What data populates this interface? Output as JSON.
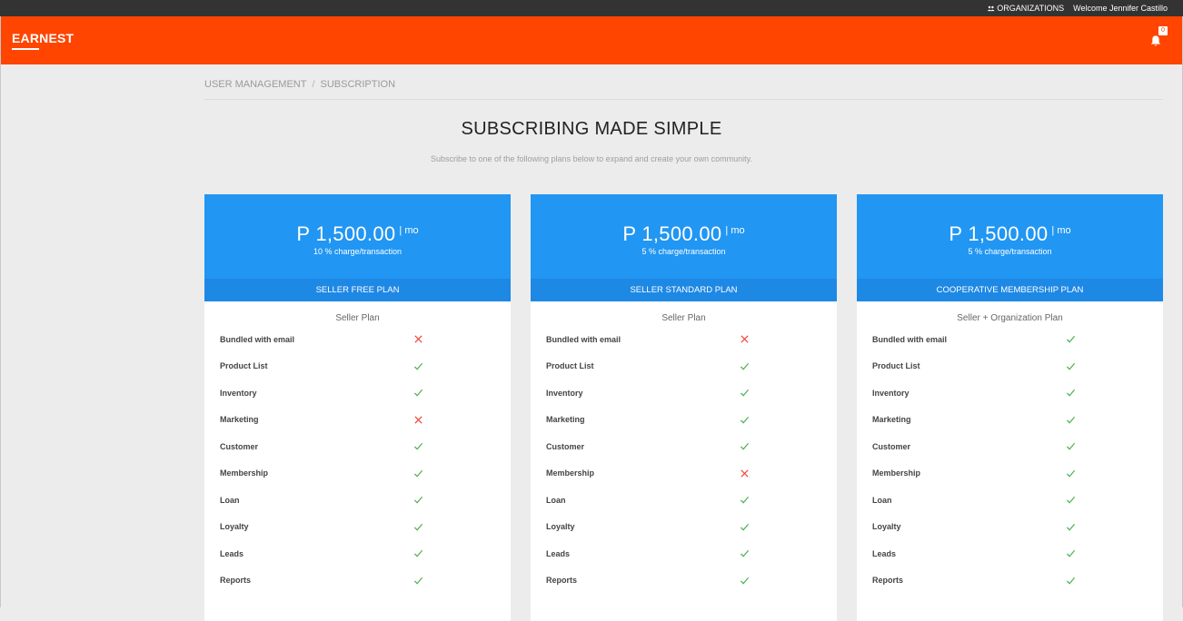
{
  "topbar": {
    "organizations_label": "ORGANIZATIONS",
    "welcome_text": "Welcome Jennifer Castillo"
  },
  "header": {
    "brand": "EARNEST",
    "notification_count": "0",
    "color": "#ff4500"
  },
  "breadcrumb": {
    "items": [
      "USER MANAGEMENT",
      "SUBSCRIPTION"
    ],
    "separator": "/"
  },
  "page": {
    "title": "SUBSCRIBING MADE SIMPLE",
    "subtitle": "Subscribe to one of the following plans below to expand and create your own community."
  },
  "colors": {
    "plan_header": "#2196f3",
    "plan_name_bar": "#1e88e5",
    "check": "#4caf50",
    "cross": "#f44336"
  },
  "plans": [
    {
      "price": "P 1,500.00",
      "per": "| mo",
      "charge": "10 % charge/transaction",
      "name": "SELLER FREE PLAN",
      "type": "Seller Plan",
      "features": [
        {
          "label": "Bundled with email",
          "icon": "cross"
        },
        {
          "label": "Product List",
          "icon": "check"
        },
        {
          "label": "Inventory",
          "icon": "check"
        },
        {
          "label": "Marketing",
          "icon": "cross"
        },
        {
          "label": "Customer",
          "icon": "check"
        },
        {
          "label": "Membership",
          "icon": "check"
        },
        {
          "label": "Loan",
          "icon": "check"
        },
        {
          "label": "Loyalty",
          "icon": "check"
        },
        {
          "label": "Leads",
          "icon": "check"
        },
        {
          "label": "Reports",
          "icon": "check"
        }
      ]
    },
    {
      "price": "P 1,500.00",
      "per": "| mo",
      "charge": "5 % charge/transaction",
      "name": "SELLER STANDARD PLAN",
      "type": "Seller Plan",
      "features": [
        {
          "label": "Bundled with email",
          "icon": "cross"
        },
        {
          "label": "Product List",
          "icon": "check"
        },
        {
          "label": "Inventory",
          "icon": "check"
        },
        {
          "label": "Marketing",
          "icon": "check"
        },
        {
          "label": "Customer",
          "icon": "check"
        },
        {
          "label": "Membership",
          "icon": "cross"
        },
        {
          "label": "Loan",
          "icon": "check"
        },
        {
          "label": "Loyalty",
          "icon": "check"
        },
        {
          "label": "Leads",
          "icon": "check"
        },
        {
          "label": "Reports",
          "icon": "check"
        }
      ]
    },
    {
      "price": "P 1,500.00",
      "per": "| mo",
      "charge": "5 % charge/transaction",
      "name": "COOPERATIVE MEMBERSHIP PLAN",
      "type": "Seller + Organization Plan",
      "features": [
        {
          "label": "Bundled with email",
          "icon": "check"
        },
        {
          "label": "Product List",
          "icon": "check"
        },
        {
          "label": "Inventory",
          "icon": "check"
        },
        {
          "label": "Marketing",
          "icon": "check"
        },
        {
          "label": "Customer",
          "icon": "check"
        },
        {
          "label": "Membership",
          "icon": "check"
        },
        {
          "label": "Loan",
          "icon": "check"
        },
        {
          "label": "Loyalty",
          "icon": "check"
        },
        {
          "label": "Leads",
          "icon": "check"
        },
        {
          "label": "Reports",
          "icon": "check"
        }
      ]
    }
  ]
}
